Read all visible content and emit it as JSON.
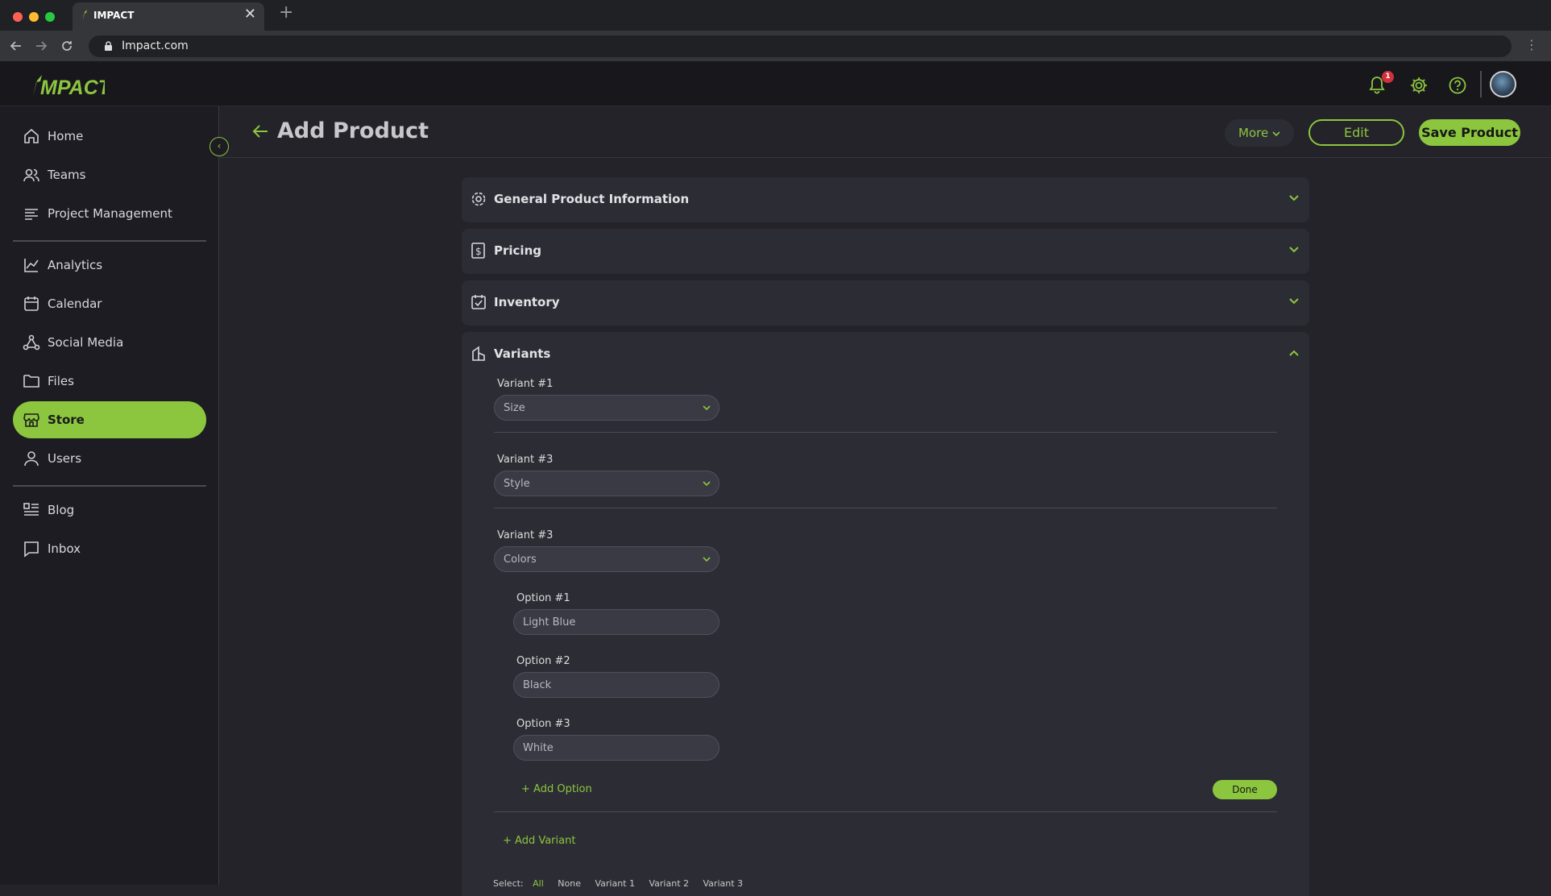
{
  "browser": {
    "tab_title": "IMPACT",
    "url": "Impact.com",
    "new_tab": "+",
    "close": "✕"
  },
  "app": {
    "logo": "IMPACT",
    "notification_count": "1",
    "accent": "#8cc63f"
  },
  "sidebar": {
    "items": [
      {
        "label": "Home",
        "icon": "home-icon"
      },
      {
        "label": "Teams",
        "icon": "teams-icon"
      },
      {
        "label": "Project Management",
        "icon": "list-icon"
      },
      {
        "label": "Analytics",
        "icon": "chart-icon"
      },
      {
        "label": "Calendar",
        "icon": "calendar-icon"
      },
      {
        "label": "Social Media",
        "icon": "share-icon"
      },
      {
        "label": "Files",
        "icon": "folder-icon"
      },
      {
        "label": "Store",
        "icon": "store-icon",
        "active": true
      },
      {
        "label": "Users",
        "icon": "user-icon"
      },
      {
        "label": "Blog",
        "icon": "blog-icon"
      },
      {
        "label": "Inbox",
        "icon": "inbox-icon"
      }
    ]
  },
  "header": {
    "title": "Add Product",
    "more_label": "More",
    "edit_label": "Edit",
    "save_label": "Save Product"
  },
  "sections": [
    {
      "title": "General Product Information",
      "icon": "gear-icon",
      "expanded": false
    },
    {
      "title": "Pricing",
      "icon": "pricing-icon",
      "expanded": false
    },
    {
      "title": "Inventory",
      "icon": "inventory-icon",
      "expanded": false
    },
    {
      "title": "Variants",
      "icon": "variants-icon",
      "expanded": true
    }
  ],
  "variants": [
    {
      "label": "Variant #1",
      "value": "Size"
    },
    {
      "label": "Variant #3",
      "value": "Style"
    },
    {
      "label": "Variant #3",
      "value": "Colors"
    }
  ],
  "options": [
    {
      "label": "Option #1",
      "value": "Light Blue"
    },
    {
      "label": "Option #2",
      "value": "Black"
    },
    {
      "label": "Option #3",
      "value": "White"
    }
  ],
  "actions": {
    "add_option": "Add Option",
    "done": "Done",
    "add_variant": "Add Variant"
  },
  "filter": {
    "label": "Select:",
    "items": [
      "All",
      "None",
      "Variant 1",
      "Variant 2",
      "Variant 3"
    ]
  }
}
